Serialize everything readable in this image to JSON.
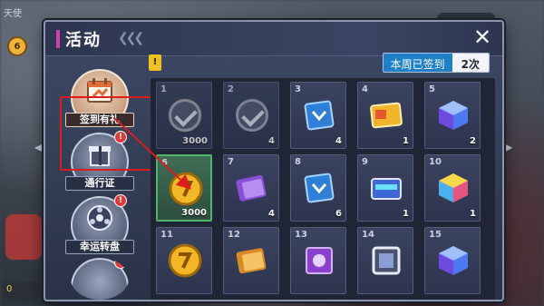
{
  "background": {
    "top_left_text": "天使",
    "coin_value": "6",
    "bottom_left_value": "0"
  },
  "panel": {
    "title": "活动",
    "close_label": "✕",
    "signed_label": "本周已签到",
    "signed_value": "2次",
    "hint_tag": "!"
  },
  "nav": {
    "items": [
      {
        "label": "签到有礼",
        "active": true
      },
      {
        "label": "通行证",
        "badge": "!"
      },
      {
        "label": "幸运转盘",
        "badge": "!"
      },
      {
        "label": "",
        "badge": "!"
      }
    ]
  },
  "days": [
    {
      "day": "1",
      "qty": "3000",
      "reward": "coin",
      "claimed": true
    },
    {
      "day": "2",
      "qty": "4",
      "reward": "book",
      "claimed": true
    },
    {
      "day": "3",
      "qty": "4",
      "reward": "blue-card"
    },
    {
      "day": "4",
      "qty": "1",
      "reward": "gold-ticket"
    },
    {
      "day": "5",
      "qty": "2",
      "reward": "cube"
    },
    {
      "day": "6",
      "qty": "3000",
      "reward": "coin",
      "today": true
    },
    {
      "day": "7",
      "qty": "4",
      "reward": "book"
    },
    {
      "day": "8",
      "qty": "6",
      "reward": "blue-card"
    },
    {
      "day": "9",
      "qty": "1",
      "reward": "ticket-blue"
    },
    {
      "day": "10",
      "qty": "1",
      "reward": "rainbow-cube"
    },
    {
      "day": "11",
      "qty": "",
      "reward": "coin"
    },
    {
      "day": "12",
      "qty": "",
      "reward": "book-gold"
    },
    {
      "day": "13",
      "qty": "",
      "reward": "purple-card"
    },
    {
      "day": "14",
      "qty": "",
      "reward": "frame"
    },
    {
      "day": "15",
      "qty": "",
      "reward": "cube"
    }
  ],
  "colors": {
    "accent": "#d03fb4",
    "highlight": "#e11a1a",
    "signed_bg": "#1f7fc7"
  }
}
